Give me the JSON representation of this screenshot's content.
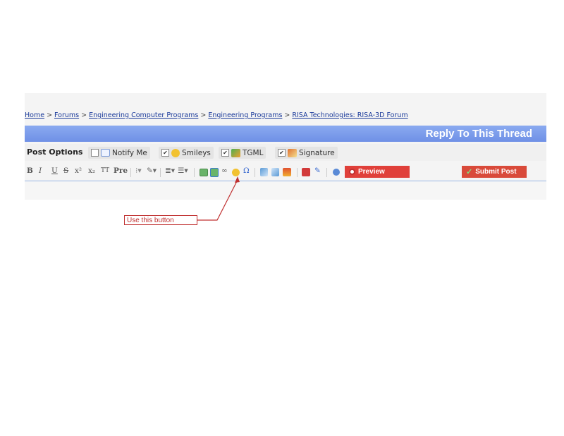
{
  "breadcrumb": {
    "items": [
      "Home",
      "Forums",
      "Engineering Computer Programs",
      "Engineering Programs",
      "RISA Technologies: RISA-3D Forum"
    ],
    "separator": ">"
  },
  "header": {
    "title": "Reply To This Thread"
  },
  "post_options": {
    "label": "Post Options",
    "options": [
      {
        "label": "Notify Me",
        "checked": false,
        "icon": "envelope-icon"
      },
      {
        "label": "Smileys",
        "checked": true,
        "icon": "smiley-icon"
      },
      {
        "label": "TGML",
        "checked": true,
        "icon": "tgml-icon"
      },
      {
        "label": "Signature",
        "checked": true,
        "icon": "signature-icon"
      }
    ]
  },
  "toolbar": {
    "bold": "B",
    "italic": "I",
    "underline": "U",
    "strike": "S",
    "superscript": "x²",
    "subscript": "x₂",
    "teletype": "TT",
    "pre": "Pre",
    "omega": "Ω",
    "preview_label": "Preview",
    "submit_label": "Submit Post",
    "preview_color": "#e0403a",
    "submit_color": "#d94a3a"
  },
  "annotation": {
    "text": "Use this button",
    "color": "#c03030"
  }
}
